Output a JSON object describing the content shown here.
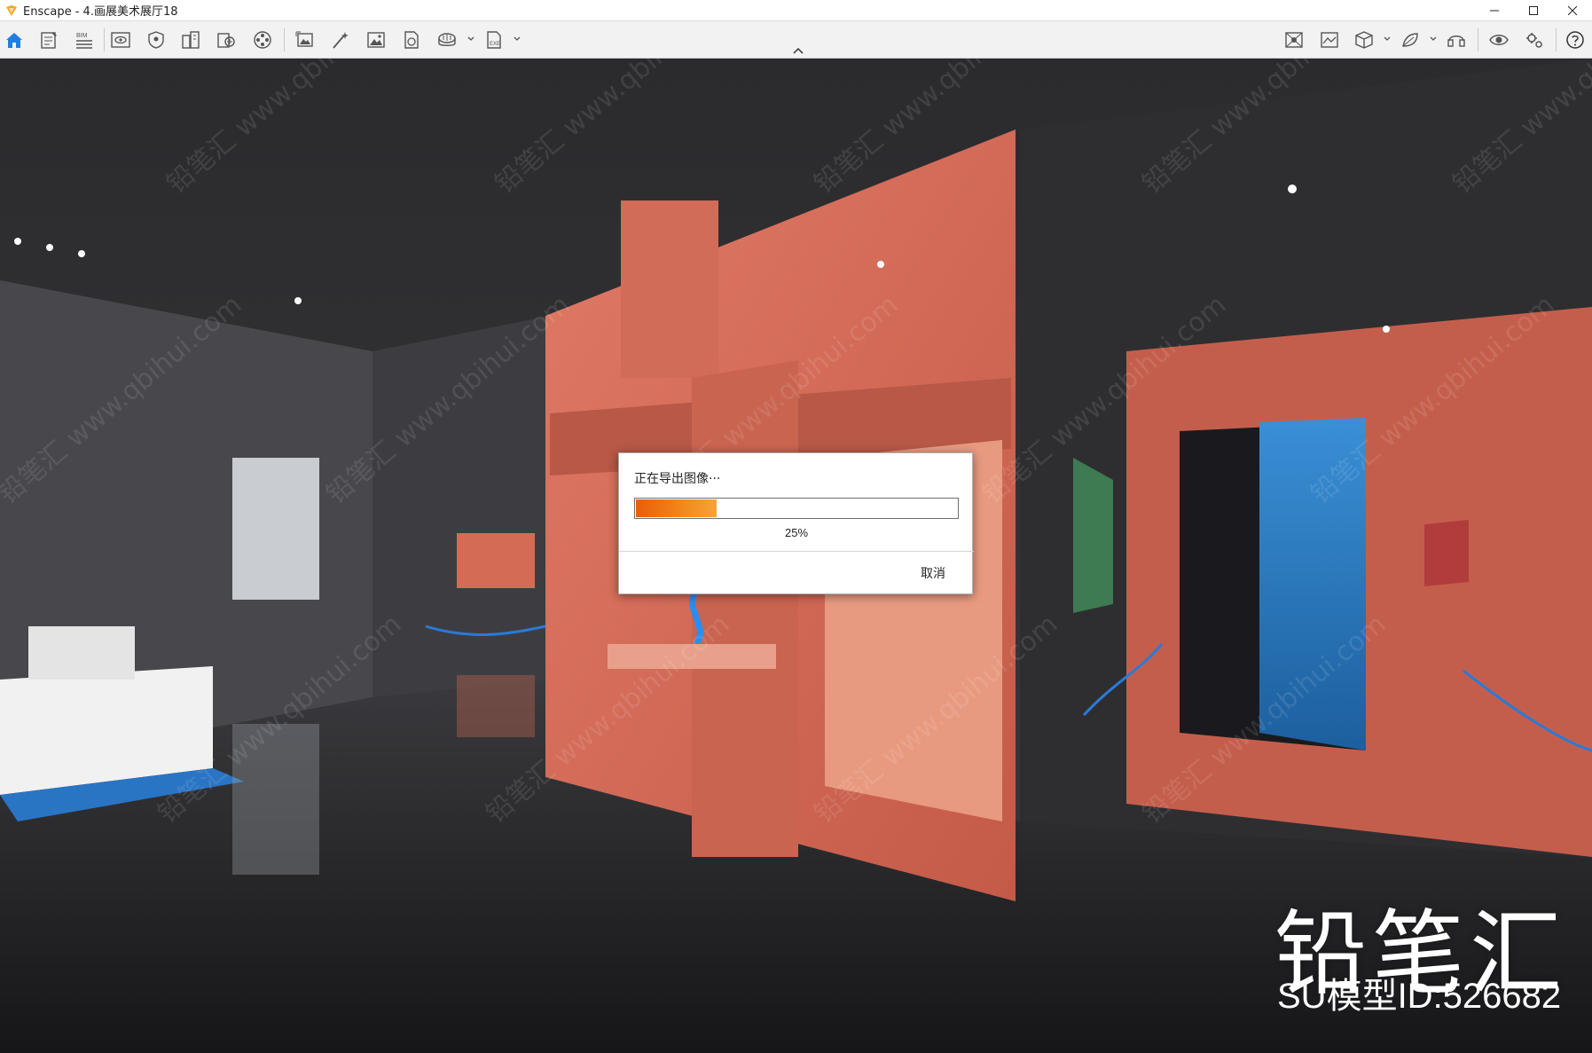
{
  "window": {
    "title": "Enscape - 4.画展美术展厅18",
    "controls": [
      "minimize",
      "maximize",
      "close"
    ]
  },
  "toolbar": {
    "left_icons": [
      "home-icon",
      "notes-icon",
      "bim-icon",
      "view-icon",
      "safe-frame-icon",
      "buildings-icon",
      "asset-library-icon",
      "film-reel-icon",
      "screenshot-icon",
      "magic-wand-icon",
      "image-icon",
      "document-image-icon",
      "batch-render-icon",
      "export-icon"
    ],
    "bim_label": "BIM",
    "right_icons": [
      "site-context-icon",
      "material-editor-icon",
      "cube-icon",
      "vr-icon",
      "headset-icon",
      "eye-icon",
      "settings-icon",
      "help-icon"
    ]
  },
  "dialog": {
    "title": "正在导出图像···",
    "progress_percent": 25,
    "progress_text": "25%",
    "cancel_label": "取消"
  },
  "watermark": {
    "brand": "铅笔汇",
    "model_id": "SU模型ID:526682",
    "tile_text": "铅笔汇 www.qbihui.com"
  },
  "colors": {
    "accent_blue": "#1f7fe0",
    "progress_orange": "#ee6a12",
    "coral": "#d96c5a",
    "blue_wall": "#2b78c0"
  }
}
